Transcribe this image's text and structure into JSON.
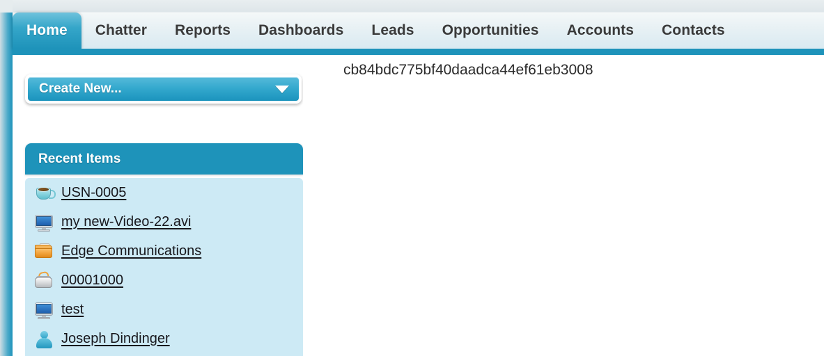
{
  "app": {
    "name": "Salesforce",
    "accent_color": "#1e93ba",
    "panel_color": "#cdeaf5",
    "tabbar_gradient_top": "#f4f8f9",
    "tabbar_gradient_bottom": "#d9eaf1"
  },
  "tabs": [
    {
      "label": "Home",
      "active": true,
      "name": "tab-home"
    },
    {
      "label": "Chatter",
      "active": false,
      "name": "tab-chatter"
    },
    {
      "label": "Reports",
      "active": false,
      "name": "tab-reports"
    },
    {
      "label": "Dashboards",
      "active": false,
      "name": "tab-dashboards"
    },
    {
      "label": "Leads",
      "active": false,
      "name": "tab-leads"
    },
    {
      "label": "Opportunities",
      "active": false,
      "name": "tab-opportunities"
    },
    {
      "label": "Accounts",
      "active": false,
      "name": "tab-accounts"
    },
    {
      "label": "Contacts",
      "active": false,
      "name": "tab-contacts"
    }
  ],
  "sidebar": {
    "create_new": {
      "label": "Create New...",
      "caret": "chevron-down-icon"
    },
    "recent_items": {
      "header": "Recent Items",
      "items": [
        {
          "label": "USN-0005",
          "icon": "coffee-cup-icon"
        },
        {
          "label": "my new-Video-22.avi",
          "icon": "monitor-icon"
        },
        {
          "label": "Edge Communications",
          "icon": "folder-icon"
        },
        {
          "label": "00001000",
          "icon": "case-icon"
        },
        {
          "label": "test",
          "icon": "monitor-icon"
        },
        {
          "label": "Joseph Dindinger",
          "icon": "person-icon"
        }
      ]
    }
  },
  "main": {
    "hash_text": "cb84bdc775bf40daadca44ef61eb3008"
  }
}
